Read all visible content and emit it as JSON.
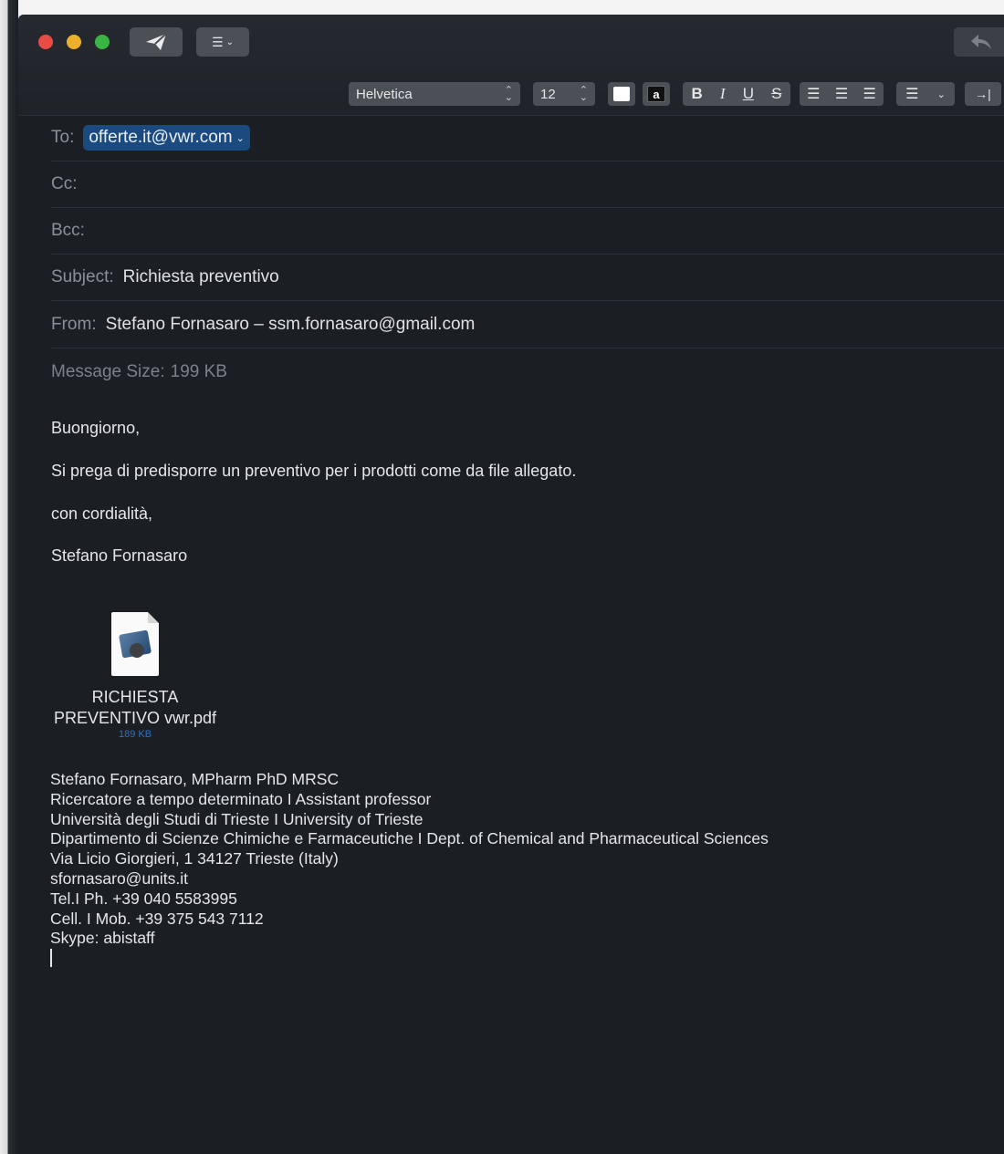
{
  "toolbar": {
    "font": "Helvetica",
    "size": "12",
    "bold": "B",
    "italic": "I",
    "underline": "U",
    "strike": "S",
    "color_label": "a"
  },
  "headers": {
    "to_label": "To:",
    "to_value": "offerte.it@vwr.com",
    "cc_label": "Cc:",
    "bcc_label": "Bcc:",
    "subject_label": "Subject:",
    "subject_value": "Richiesta preventivo",
    "from_label": "From:",
    "from_value": "Stefano Fornasaro – ssm.fornasaro@gmail.com",
    "size_label": "Message Size:",
    "size_value": "199 KB"
  },
  "body": {
    "greeting": "Buongiorno,",
    "line1": "Si prega di predisporre un preventivo per i prodotti come da file allegato.",
    "closing": "con cordialità,",
    "name": "Stefano Fornasaro"
  },
  "attachment": {
    "name_line1": "RICHIESTA",
    "name_line2": "PREVENTIVO vwr.pdf",
    "size": "189 KB"
  },
  "signature": [
    "Stefano Fornasaro, MPharm PhD MRSC",
    "Ricercatore a tempo determinato I Assistant professor",
    "Università degli Studi di Trieste I University of Trieste",
    "Dipartimento di Scienze Chimiche e Farmaceutiche I  Dept. of Chemical and Pharmaceutical Sciences",
    "Via Licio Giorgieri, 1 34127 Trieste (Italy)",
    "sfornasaro@units.it",
    "Tel.I Ph. +39 040 5583995",
    "Cell. I Mob. +39 375 543 7112",
    "Skype: abistaff"
  ],
  "colors": {
    "window_bg": "#1b1f24",
    "chip_bg": "#1b4a7e",
    "close": "#e94c45",
    "minimize": "#ecb12b",
    "maximize": "#3ab442"
  }
}
